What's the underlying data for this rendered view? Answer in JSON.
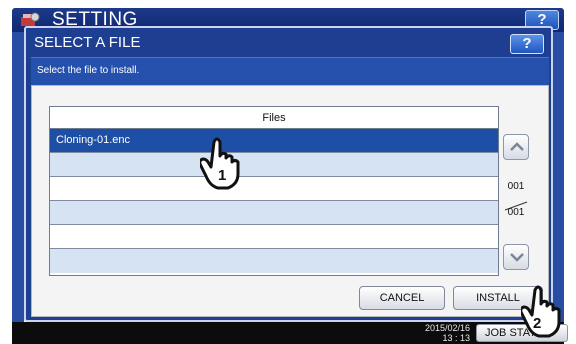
{
  "background": {
    "title": "SETTING",
    "help_label": "?",
    "clock_line1": "2015/02/16",
    "clock_line2": "13 : 13",
    "job_status_label": "JOB STATUS"
  },
  "dialog": {
    "title": "SELECT A FILE",
    "help_label": "?",
    "message": "Select the file to install.",
    "table_header": "Files",
    "rows": [
      {
        "name": "Cloning-01.enc",
        "selected": true
      },
      {
        "name": "",
        "selected": false
      },
      {
        "name": "",
        "selected": false
      },
      {
        "name": "",
        "selected": false
      },
      {
        "name": "",
        "selected": false
      },
      {
        "name": "",
        "selected": false
      }
    ],
    "page_current": "001",
    "page_total": "001",
    "cancel_label": "CANCEL",
    "install_label": "INSTALL"
  },
  "annotations": {
    "step1": "1",
    "step2": "2"
  },
  "colors": {
    "dialog_blue": "#1e3f91",
    "selected_row": "#1e4fa7",
    "alt_row": "#d6e3f3"
  }
}
